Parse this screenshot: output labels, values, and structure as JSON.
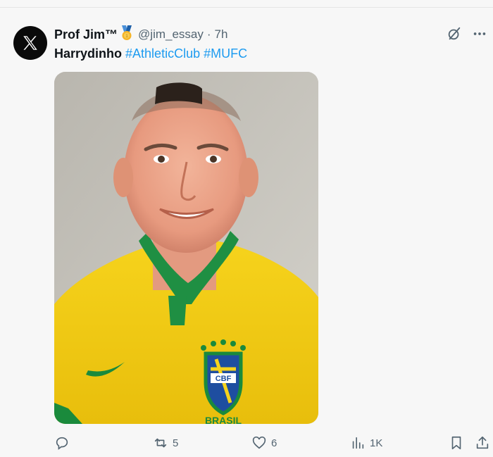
{
  "tweet": {
    "author": {
      "name": "Prof Jim™",
      "handle": "@jim_essay",
      "separator": "·",
      "time": "7h",
      "avatar_icon": "x-logo-icon",
      "badge_icon": "medal-icon"
    },
    "text": {
      "plain": "Harrydinho",
      "hashtags": [
        "#AthleticClub",
        "#MUFC"
      ]
    },
    "media": {
      "jersey_text": "BRASIL",
      "crest_text": "CBF"
    },
    "stats": {
      "replies": "",
      "retweets": "5",
      "likes": "6",
      "views": "1K"
    }
  },
  "colors": {
    "link": "#1d9bf0",
    "muted": "#536471",
    "text": "#0f1419",
    "background": "#f7f7f7"
  }
}
